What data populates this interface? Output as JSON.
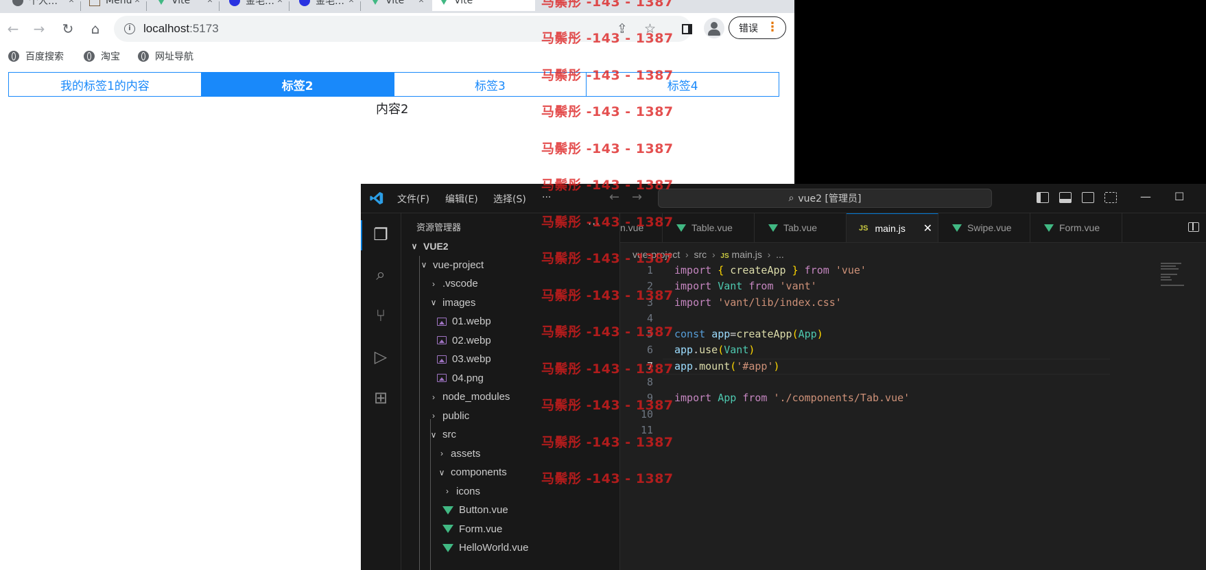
{
  "browser": {
    "tabs": [
      {
        "title": "个人…",
        "favicon": "globe-icon"
      },
      {
        "title": "Menu",
        "favicon": "image-icon"
      },
      {
        "title": "Vite",
        "favicon": "vite-icon"
      },
      {
        "title": "金毛…",
        "favicon": "baidu-icon"
      },
      {
        "title": "金毛…",
        "favicon": "baidu-icon"
      },
      {
        "title": "Vite",
        "favicon": "vite-icon"
      },
      {
        "title": "Vite",
        "favicon": "vite-icon"
      }
    ],
    "url": "localhost",
    "url_port": ":5173",
    "error_button": "错误",
    "bookmarks": [
      "百度搜索",
      "淘宝",
      "网址导航"
    ]
  },
  "page": {
    "tabs": [
      {
        "label": "我的标签1的内容",
        "active": false
      },
      {
        "label": "标签2",
        "active": true
      },
      {
        "label": "标签3",
        "active": false
      },
      {
        "label": "标签4",
        "active": false
      }
    ],
    "content": "内容2",
    "accent": "#1989fa"
  },
  "vscode": {
    "menus": [
      "文件(F)",
      "编辑(E)",
      "选择(S)",
      "···"
    ],
    "command_center": "vue2 [管理员]",
    "explorer_title": "资源管理器",
    "explorer_more": "···",
    "tree": [
      {
        "label": "VUE2",
        "depth": 0,
        "kind": "folder-open",
        "bold": true
      },
      {
        "label": "vue-project",
        "depth": 1,
        "kind": "folder-open"
      },
      {
        "label": ".vscode",
        "depth": 2,
        "kind": "folder-closed"
      },
      {
        "label": "images",
        "depth": 2,
        "kind": "folder-open"
      },
      {
        "label": "01.webp",
        "depth": 3,
        "kind": "image"
      },
      {
        "label": "02.webp",
        "depth": 3,
        "kind": "image"
      },
      {
        "label": "03.webp",
        "depth": 3,
        "kind": "image"
      },
      {
        "label": "04.png",
        "depth": 3,
        "kind": "image"
      },
      {
        "label": "node_modules",
        "depth": 2,
        "kind": "folder-closed"
      },
      {
        "label": "public",
        "depth": 2,
        "kind": "folder-closed"
      },
      {
        "label": "src",
        "depth": 2,
        "kind": "folder-open"
      },
      {
        "label": "assets",
        "depth": 3,
        "kind": "folder-closed"
      },
      {
        "label": "components",
        "depth": 3,
        "kind": "folder-open"
      },
      {
        "label": "icons",
        "depth": 4,
        "kind": "folder-closed"
      },
      {
        "label": "Button.vue",
        "depth": 4,
        "kind": "vue"
      },
      {
        "label": "Form.vue",
        "depth": 4,
        "kind": "vue"
      },
      {
        "label": "HelloWorld.vue",
        "depth": 4,
        "kind": "vue"
      }
    ],
    "editor_tabs": [
      {
        "label": "n.vue",
        "kind": "plain"
      },
      {
        "label": "Table.vue",
        "kind": "vue"
      },
      {
        "label": "Tab.vue",
        "kind": "vue"
      },
      {
        "label": "main.js",
        "kind": "js",
        "active": true
      },
      {
        "label": "Swipe.vue",
        "kind": "vue"
      },
      {
        "label": "Form.vue",
        "kind": "vue"
      }
    ],
    "breadcrumb": [
      "vue-project",
      "src",
      "main.js",
      "..."
    ],
    "js_badge": "JS",
    "close_glyph": "✕",
    "current_line": 7,
    "code": [
      "import { createApp } from 'vue'",
      "import Vant from 'vant'",
      "import 'vant/lib/index.css'",
      "",
      "const app=createApp(App)",
      "app.use(Vant)",
      "app.mount('#app')",
      "",
      "import App from './components/Tab.vue'",
      "",
      ""
    ]
  },
  "watermark": "马鬃彤 -143 - 1387"
}
